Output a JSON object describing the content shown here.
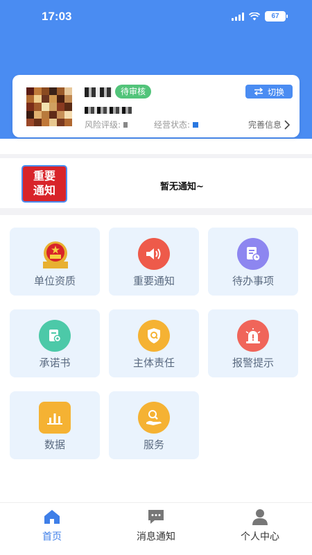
{
  "status_bar": {
    "time": "17:03",
    "battery": "67"
  },
  "company": {
    "status_badge": "待审核",
    "switch_label": "切换",
    "risk_label": "风险评级:",
    "business_label": "经营状态:",
    "more_label": "完善信息"
  },
  "notice": {
    "logo_line1": "重要",
    "logo_line2": "通知",
    "text": "暂无通知~"
  },
  "grid": [
    {
      "label": "单位资质",
      "icon": "national-emblem-icon",
      "color": "#d8242a"
    },
    {
      "label": "重要通知",
      "icon": "speaker-icon",
      "color": "#ee5a4a"
    },
    {
      "label": "待办事项",
      "icon": "document-clock-icon",
      "color": "#8d86f0"
    },
    {
      "label": "承诺书",
      "icon": "document-seal-icon",
      "color": "#4cc9a8"
    },
    {
      "label": "主体责任",
      "icon": "shield-icon",
      "color": "#f5b233"
    },
    {
      "label": "报警提示",
      "icon": "alarm-icon",
      "color": "#f0655a"
    },
    {
      "label": "数据",
      "icon": "bar-chart-icon",
      "color": "#f5b233"
    },
    {
      "label": "服务",
      "icon": "service-hand-icon",
      "color": "#f5b233"
    }
  ],
  "tabbar": [
    {
      "label": "首页",
      "icon": "home-icon",
      "active": true
    },
    {
      "label": "消息通知",
      "icon": "message-icon",
      "active": false
    },
    {
      "label": "个人中心",
      "icon": "person-icon",
      "active": false
    }
  ],
  "colors": {
    "primary": "#4a8cf2",
    "tile_bg": "#eaf3fd",
    "badge_green": "#52c47a"
  }
}
